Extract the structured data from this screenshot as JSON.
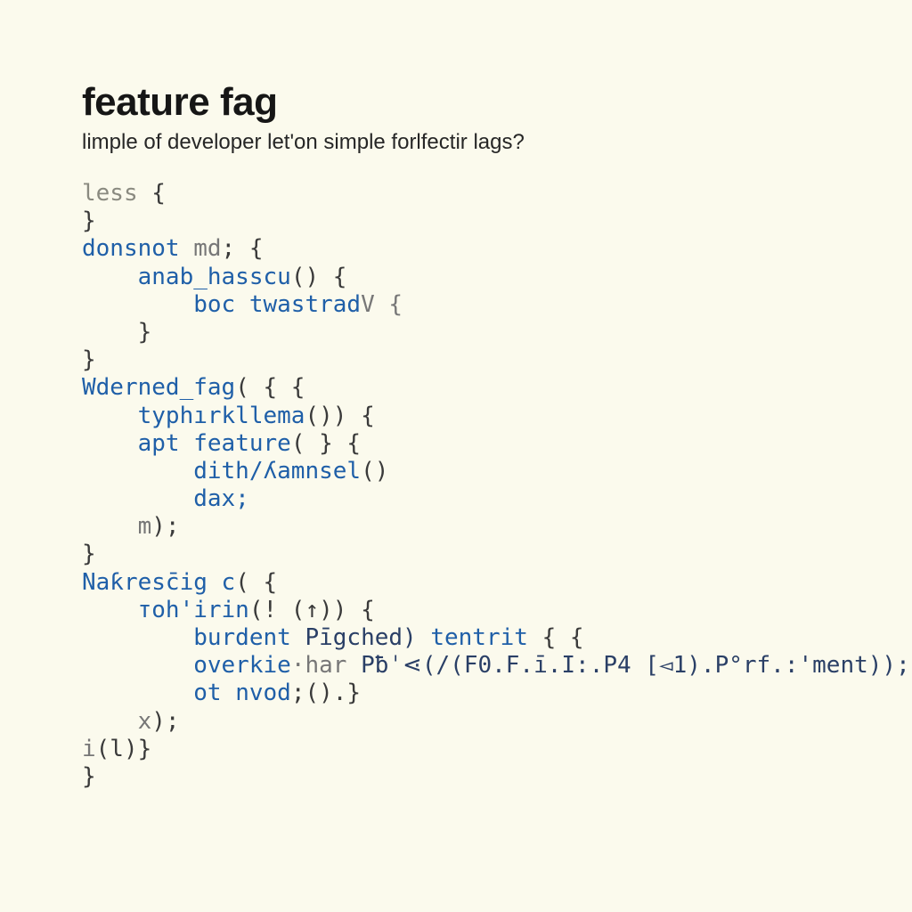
{
  "title": "feature fag",
  "subtitle": "limple of developer let'on simple forlfectir lags?",
  "code": {
    "l1_token": "less",
    "l1_brace": " {",
    "l2": "}",
    "l3_a": "donsnot ",
    "l3_b": "md",
    "l3_c": "; {",
    "l4_a": "    anab_hasscu",
    "l4_b": "() {",
    "l5_a": "        boc ",
    "l5_b": "twastrad",
    "l5_c": "V {",
    "l6": "    }",
    "l7": "}",
    "l8_a": "Wderned_fag",
    "l8_b": "( { {",
    "l9_a": "    typhırkllema",
    "l9_b": "()) {",
    "l10_a": "    apt ",
    "l10_b": "feature",
    "l10_c": "( } {",
    "l11_a": "        dith/ʎamnsel",
    "l11_b": "()",
    "l12": "        dax;",
    "l13_a": "    m",
    "l13_b": ");",
    "l14": "}",
    "l15_a": "Naƙresc̄ig c",
    "l15_b": "( {",
    "l16_a": "    тoh'irin",
    "l16_b": "(! (↑)) {",
    "l17_a": "        burdent ",
    "l17_b": "Pīgched) ",
    "l17_c": "tentrit",
    "l17_d": " { {",
    "l18_a": "        overkie",
    "l18_b": "·har ",
    "l18_c": "Pƀˈ⋖(/(",
    "l18_d": "F0.F.ī.I:.P4 [◅1).P°rf.:'ment));",
    "l19_a": "        ot ",
    "l19_b": "nvod",
    "l19_c": ";().}",
    "l20_a": "    x",
    "l20_b": ");",
    "l21_a": "i",
    "l21_b": "(l)}",
    "l22": "}"
  }
}
